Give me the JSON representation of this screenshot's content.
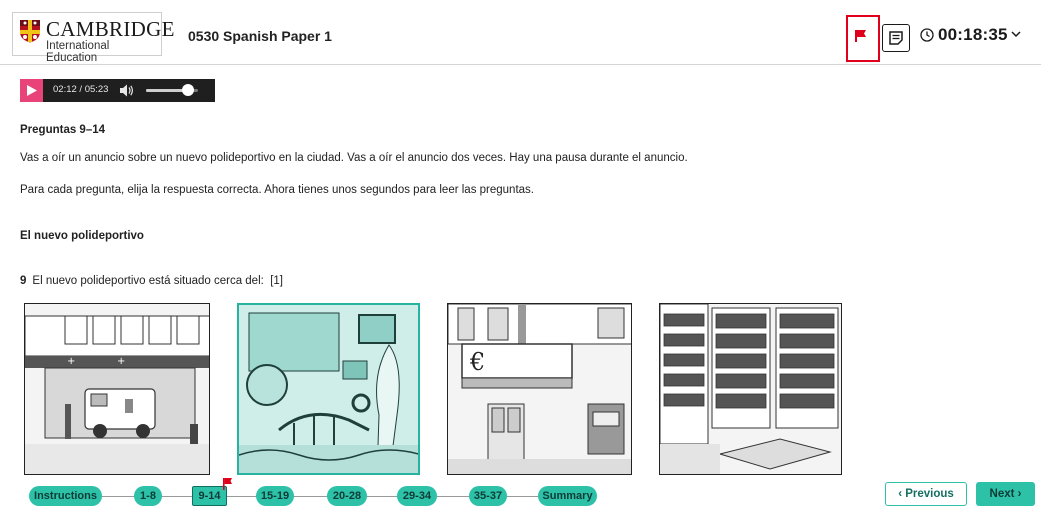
{
  "header": {
    "logo_main": "CAMBRIDGE",
    "logo_sub": "International Education",
    "paper_title": "0530 Spanish Paper 1",
    "timer": "00:18:35"
  },
  "audio": {
    "time": "02:12 / 05:23",
    "volume_level": 0.8
  },
  "content": {
    "section_heading": "Preguntas 9–14",
    "intro_1": "Vas a oír un anuncio sobre un nuevo polideportivo en la ciudad. Vas a oír el anuncio dos veces. Hay una pausa durante el anuncio.",
    "intro_2": "Para cada pregunta, elija la respuesta correcta. Ahora tienes unos segundos para leer las preguntas.",
    "subheading": "El nuevo polideportivo",
    "question": {
      "number": "9",
      "text": "El nuevo polideportivo está situado cerca del:",
      "marks": "[1]"
    },
    "options": [
      {
        "name": "hospital",
        "selected": false
      },
      {
        "name": "museo",
        "selected": true
      },
      {
        "name": "banco",
        "selected": false
      },
      {
        "name": "biblioteca",
        "selected": false
      }
    ]
  },
  "nav": {
    "items": [
      {
        "label": "Instructions"
      },
      {
        "label": "1-8"
      },
      {
        "label": "9-14"
      },
      {
        "label": "15-19"
      },
      {
        "label": "20-28"
      },
      {
        "label": "29-34"
      },
      {
        "label": "35-37"
      },
      {
        "label": "Summary"
      }
    ],
    "prev_label": "‹ Previous",
    "next_label": "Next ›"
  },
  "colors": {
    "accent": "#2dc1a8",
    "flag": "#e0001b",
    "play": "#e8447a"
  }
}
